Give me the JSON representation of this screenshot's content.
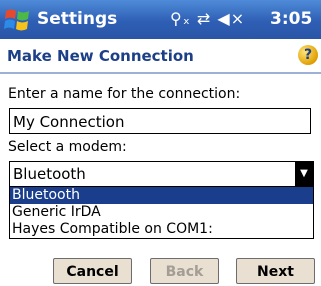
{
  "titlebar": {
    "title": "Settings",
    "status_icons": "⚲ₓ ⇄ ◀×",
    "time": "3:05"
  },
  "header": {
    "title": "Make New Connection",
    "help_icon": "help-icon"
  },
  "form": {
    "name_label": "Enter a name for the connection:",
    "name_value": "My Connection",
    "modem_label": "Select a modem:",
    "modem_selected": "Bluetooth",
    "modem_options": [
      "Bluetooth",
      "Generic IrDA",
      "Hayes Compatible on COM1:"
    ]
  },
  "buttons": {
    "cancel": "Cancel",
    "back": "Back",
    "next": "Next"
  },
  "colors": {
    "titlebar": "#2e5fb5",
    "header_text": "#1d3f88",
    "selection": "#1a3e8c",
    "button_face": "#e9e0d2"
  }
}
